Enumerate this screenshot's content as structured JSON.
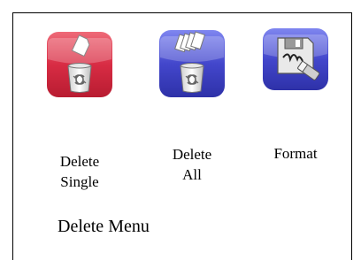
{
  "screen": {
    "title": "Delete Menu"
  },
  "items": [
    {
      "label": "Delete\nSingle",
      "icon": "delete-single-icon",
      "color": "#d8324a"
    },
    {
      "label": "Delete\nAll",
      "icon": "delete-all-icon",
      "color": "#3f43c4"
    },
    {
      "label": "Format",
      "icon": "format-icon",
      "color": "#3f43c4"
    }
  ]
}
